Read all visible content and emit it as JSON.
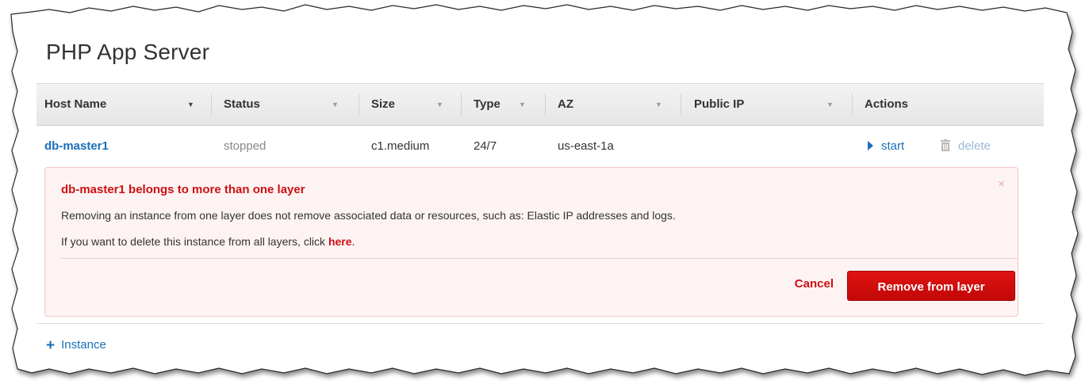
{
  "page": {
    "title": "PHP App Server"
  },
  "table": {
    "columns": [
      {
        "label": "Host Name"
      },
      {
        "label": "Status"
      },
      {
        "label": "Size"
      },
      {
        "label": "Type"
      },
      {
        "label": "AZ"
      },
      {
        "label": "Public IP"
      },
      {
        "label": "Actions"
      }
    ],
    "rows": [
      {
        "host_name": "db-master1",
        "status": "stopped",
        "size": "c1.medium",
        "type": "24/7",
        "az": "us-east-1a",
        "public_ip": "",
        "actions": {
          "start_label": "start",
          "delete_label": "delete"
        }
      }
    ]
  },
  "alert": {
    "title": "db-master1 belongs to more than one layer",
    "close_glyph": "×",
    "line1": "Removing an instance from one layer does not remove associated data or resources, such as: Elastic IP addresses and logs.",
    "line2_prefix": "If you want to delete this instance from all layers, click ",
    "line2_link": "here",
    "line2_suffix": ".",
    "cancel_label": "Cancel",
    "remove_label": "Remove from layer"
  },
  "footer": {
    "add_instance_label": "Instance"
  },
  "icons": {
    "sort": "sort-caret-icon",
    "start": "play-triangle-icon",
    "delete": "trash-icon",
    "close": "close-icon",
    "add": "plus-icon"
  },
  "colors": {
    "link_blue": "#1a6fb8",
    "alert_red": "#cc1111",
    "button_red": "#d80d0d",
    "alert_bg": "#fdf3f3",
    "header_bg": "#ececec"
  }
}
